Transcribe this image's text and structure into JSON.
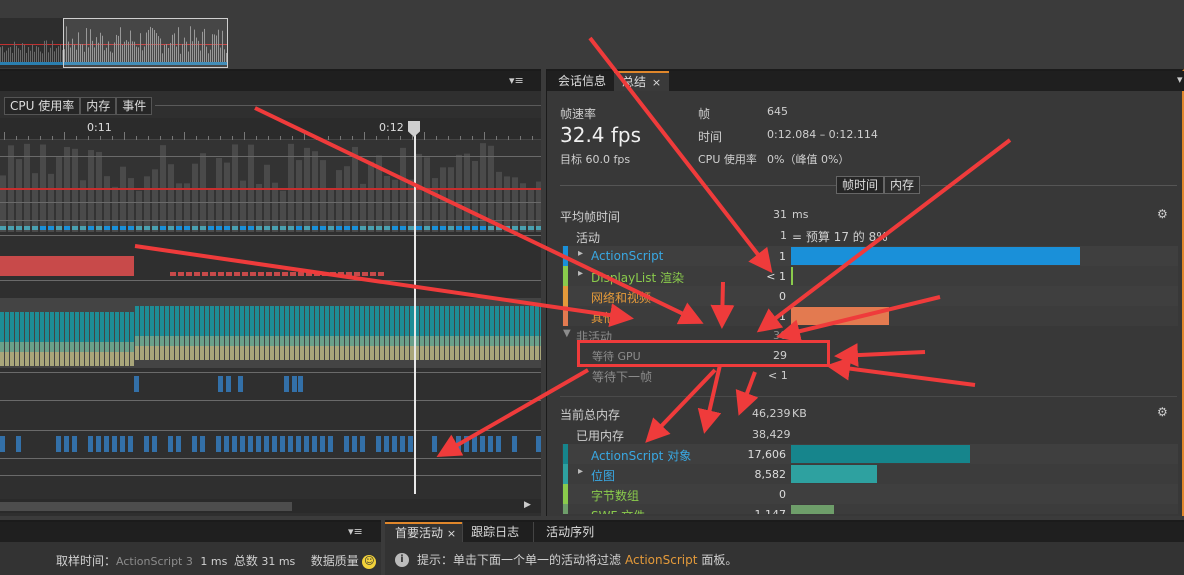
{
  "left_panel": {
    "tabs": [
      "CPU 使用率",
      "内存",
      "事件"
    ],
    "time_ticks": [
      "0:11",
      "0:12"
    ]
  },
  "right_panel": {
    "tabs": [
      {
        "label": "会话信息",
        "active": false
      },
      {
        "label": "总结",
        "active": true,
        "close": "×"
      }
    ],
    "framerate_label": "帧速率",
    "fps": "32.4 fps",
    "target": "目标 60.0 fps",
    "frame_label": "帧",
    "frame_value": "645",
    "time_label": "时间",
    "time_value": "0:12.084 – 0:12.114",
    "cpu_label": "CPU 使用率",
    "cpu_value": "0%（峰值 0%）",
    "toggle": [
      "帧时间",
      "内存"
    ],
    "frame_time": {
      "header_label": "平均帧时间",
      "header_value": "31",
      "header_unit": "ms",
      "active_label": "活动",
      "active_value": "1",
      "active_note": "= 预算 17 的 8%",
      "rows": [
        {
          "label": "ActionScript",
          "value": "1",
          "color": "#1a90d9",
          "text_color": "blue",
          "bar": 0.74,
          "expand": true
        },
        {
          "label": "DisplayList 渲染",
          "value": "< 1",
          "color": "#8acb4c",
          "text_color": "green",
          "bar": 0.004,
          "expand": true
        },
        {
          "label": "网络和视频",
          "value": "0",
          "color": "#e49a3a",
          "text_color": "orange",
          "bar": 0,
          "expand": false
        },
        {
          "label": "其他",
          "value": "1",
          "color": "#e37a50",
          "text_color": "orange",
          "bar": 0.25,
          "expand": false
        }
      ],
      "inactive_label": "非活动",
      "inactive_value": "30",
      "wait_gpu_label": "等待 GPU",
      "wait_gpu_value": "29",
      "wait_next_label": "等待下一帧",
      "wait_next_value": "< 1"
    },
    "memory": {
      "header_label": "当前总内存",
      "header_value": "46,239",
      "header_unit": "KB",
      "used_label": "已用内存",
      "used_value": "38,429",
      "rows": [
        {
          "label": "ActionScript 对象",
          "value": "17,606",
          "color": "#16858c",
          "text_color": "blue",
          "bar": 0.46,
          "expand": false
        },
        {
          "label": "位图",
          "value": "8,582",
          "color": "#2ea1a0",
          "text_color": "blue",
          "bar": 0.22,
          "expand": true
        },
        {
          "label": "字节数组",
          "value": "0",
          "color": "#8acb4c",
          "text_color": "green",
          "bar": 0,
          "expand": false
        },
        {
          "label": "SWF 文件",
          "value": "1,147",
          "color": "#6e9e6a",
          "text_color": "green",
          "bar": 0.11,
          "expand": false
        }
      ]
    }
  },
  "bottom_left": {
    "sample_label": "取样时间：",
    "sample_src": "ActionScript 3",
    "sample_ms": "1 ms",
    "total_label": "总数",
    "total_ms": "31 ms",
    "quality_label": "数据质量",
    "quality_icon": "smiley-icon"
  },
  "bottom_right": {
    "tabs": [
      {
        "label": "首要活动",
        "active": true,
        "close": "×"
      },
      {
        "label": "跟踪日志",
        "active": false
      },
      {
        "label": "活动序列",
        "active": false
      }
    ],
    "hint_prefix": "提示：单击下面一个单一的活动将过滤",
    "hint_highlight": "ActionScript",
    "hint_suffix": "面板。"
  },
  "annotation_color": "#ef3b3b"
}
